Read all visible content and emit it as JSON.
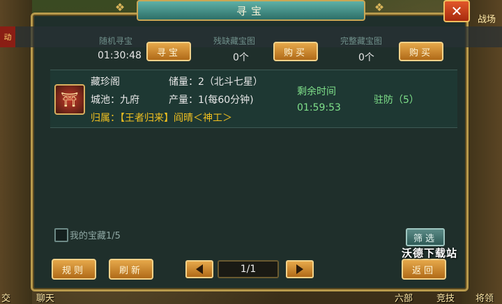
{
  "title": "寻宝",
  "close_label": "✕",
  "top_right_nav": "战场",
  "left_tab": "动",
  "stats": [
    {
      "label": "随机寻宝",
      "value": "01:30:48",
      "button": "寻宝"
    },
    {
      "label": "残缺藏宝图",
      "value": "0个",
      "button": "购买"
    },
    {
      "label": "完整藏宝图",
      "value": "0个",
      "button": "购买"
    }
  ],
  "entry": {
    "icon": "pagoda-icon",
    "name": "藏珍阁",
    "city": "城池：九府",
    "owner": "归属：【王者归来】阎晴＜神工＞",
    "storage": "储量：2（北斗七星）",
    "output": "产量：1(每60分钟)",
    "remaining_label": "剩余时间",
    "remaining_time": "01:59:53",
    "garrison": "驻防（5）"
  },
  "my_treasure": "我的宝藏1/5",
  "filter_label": "筛选",
  "rules_label": "规则",
  "refresh_label": "刷新",
  "page_indicator": "1/1",
  "back_label": "返回",
  "watermark": "沃德下载站",
  "bottom_nav": {
    "chat": "聊天",
    "left_edge": "交",
    "six_dept": "六部",
    "contest": "竞技",
    "general": "将领"
  },
  "colors": {
    "panel_bg": "#1f2f2b",
    "gold_border": "#b89a4c",
    "title_teal": "#2d6f68",
    "owner_gold": "#f0c020",
    "time_green": "#7fe08a"
  }
}
